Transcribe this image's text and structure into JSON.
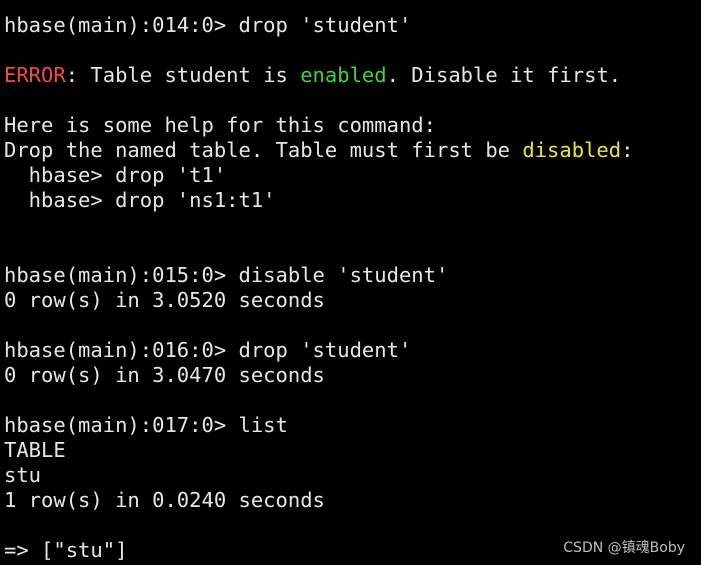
{
  "colors": {
    "text": "#e6e6e6",
    "error": "#f04a4a",
    "enabled": "#3fd43f",
    "disabled": "#e8e83a",
    "background": "#000000"
  },
  "lines": [
    [
      {
        "t": "hbase(main):014:0> drop 'student'"
      }
    ],
    [],
    [
      {
        "t": "ERROR",
        "c": "error"
      },
      {
        "t": ": Table student is "
      },
      {
        "t": "enabled",
        "c": "enabled"
      },
      {
        "t": ". Disable it first."
      }
    ],
    [],
    [
      {
        "t": "Here is some help for this command:"
      }
    ],
    [
      {
        "t": "Drop the named table. Table must first be "
      },
      {
        "t": "disabled",
        "c": "disabled"
      },
      {
        "t": ":"
      }
    ],
    [
      {
        "t": "  hbase> drop 't1'"
      }
    ],
    [
      {
        "t": "  hbase> drop 'ns1:t1'"
      }
    ],
    [],
    [],
    [
      {
        "t": "hbase(main):015:0> disable 'student'"
      }
    ],
    [
      {
        "t": "0 row(s) in 3.0520 seconds"
      }
    ],
    [],
    [
      {
        "t": "hbase(main):016:0> drop 'student'"
      }
    ],
    [
      {
        "t": "0 row(s) in 3.0470 seconds"
      }
    ],
    [],
    [
      {
        "t": "hbase(main):017:0> list"
      }
    ],
    [
      {
        "t": "TABLE"
      }
    ],
    [
      {
        "t": "stu"
      }
    ],
    [
      {
        "t": "1 row(s) in 0.0240 seconds"
      }
    ],
    [],
    [
      {
        "t": "=> [\"stu\"]"
      }
    ]
  ],
  "watermark": "CSDN @镇魂Boby"
}
